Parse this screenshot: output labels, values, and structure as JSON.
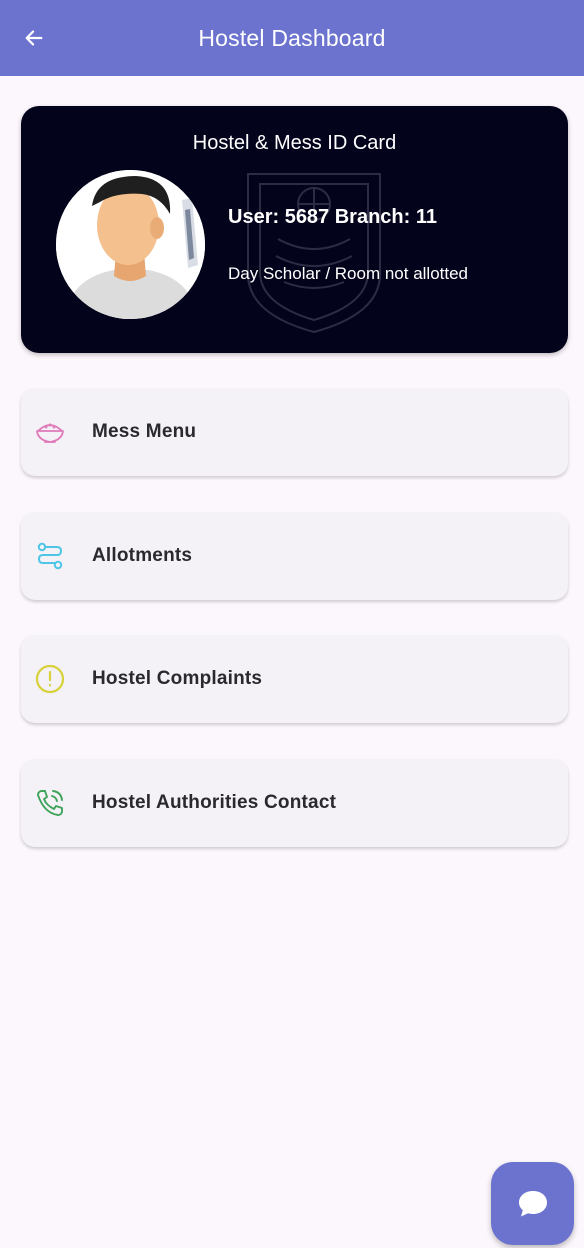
{
  "appbar": {
    "title": "Hostel Dashboard",
    "back_icon": "arrow-left-icon",
    "color": "#6b73cf"
  },
  "id_card": {
    "title": "Hostel & Mess ID Card",
    "user_line": "User: 5687 Branch: 11",
    "room_status": "Day Scholar / Room not allotted",
    "background": "#03031c"
  },
  "menu": {
    "items": [
      {
        "label": "Mess Menu",
        "icon": "rice-bowl-icon",
        "icon_color": "#e07ab9"
      },
      {
        "label": "Allotments",
        "icon": "route-icon",
        "icon_color": "#4fc6e8"
      },
      {
        "label": "Hostel Complaints",
        "icon": "alert-circle-icon",
        "icon_color": "#d8d23a"
      },
      {
        "label": "Hostel Authorities Contact",
        "icon": "phone-call-icon",
        "icon_color": "#3fa35a"
      }
    ]
  },
  "chat_fab": {
    "icon": "chat-bubble-icon"
  }
}
